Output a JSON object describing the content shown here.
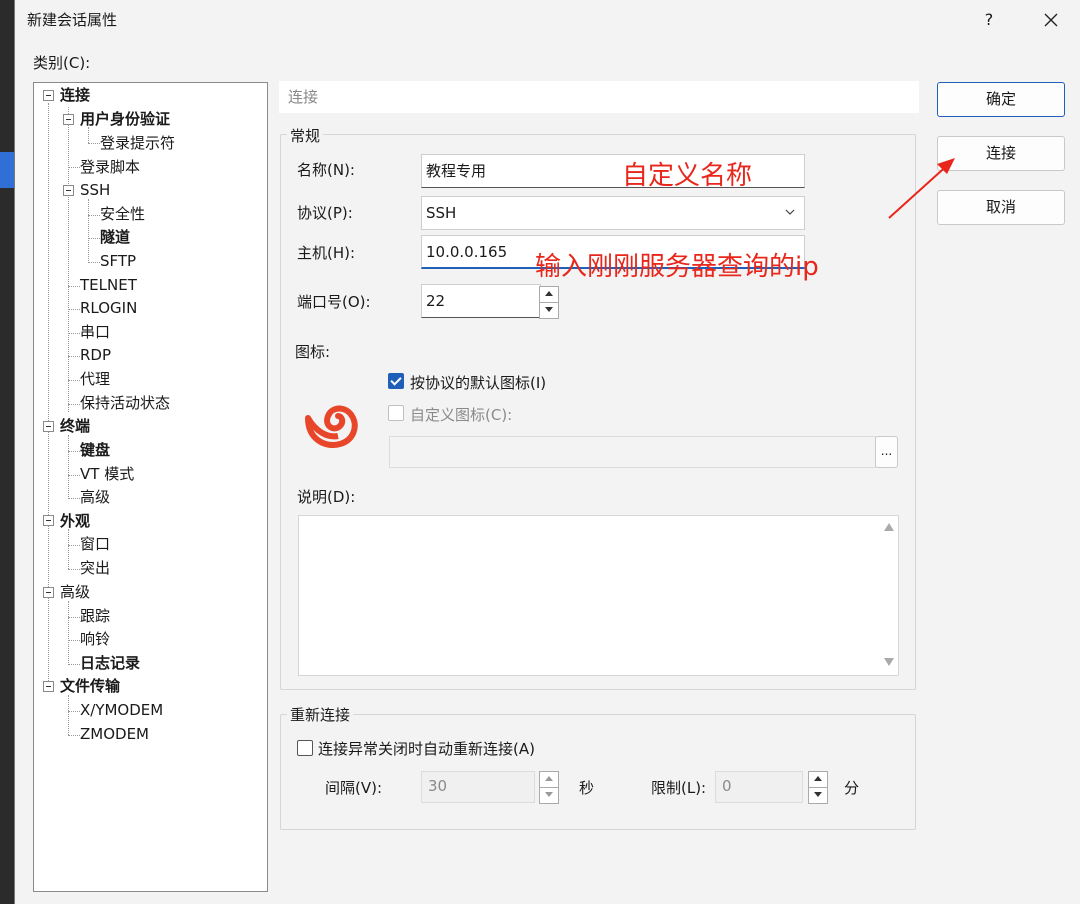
{
  "window": {
    "title": "新建会话属性",
    "help_label": "?"
  },
  "category_label": "类别(C):",
  "tree": {
    "items": [
      {
        "label": "连接",
        "bold": true
      },
      {
        "label": "用户身份验证",
        "bold": true
      },
      {
        "label": "登录提示符",
        "bold": false
      },
      {
        "label": "登录脚本",
        "bold": false
      },
      {
        "label": "SSH",
        "bold": false
      },
      {
        "label": "安全性",
        "bold": false
      },
      {
        "label": "隧道",
        "bold": true
      },
      {
        "label": "SFTP",
        "bold": false
      },
      {
        "label": "TELNET",
        "bold": false
      },
      {
        "label": "RLOGIN",
        "bold": false
      },
      {
        "label": "串口",
        "bold": false
      },
      {
        "label": "RDP",
        "bold": false
      },
      {
        "label": "代理",
        "bold": false
      },
      {
        "label": "保持活动状态",
        "bold": false
      },
      {
        "label": "终端",
        "bold": true
      },
      {
        "label": "键盘",
        "bold": true
      },
      {
        "label": "VT 模式",
        "bold": false
      },
      {
        "label": "高级",
        "bold": false
      },
      {
        "label": "外观",
        "bold": true
      },
      {
        "label": "窗口",
        "bold": false
      },
      {
        "label": "突出",
        "bold": false
      },
      {
        "label": "高级",
        "bold": false
      },
      {
        "label": "跟踪",
        "bold": false
      },
      {
        "label": "响铃",
        "bold": false
      },
      {
        "label": "日志记录",
        "bold": true
      },
      {
        "label": "文件传输",
        "bold": true
      },
      {
        "label": "X/YMODEM",
        "bold": false
      },
      {
        "label": "ZMODEM",
        "bold": false
      }
    ]
  },
  "section_header": "连接",
  "general": {
    "title": "常规",
    "name_label": "名称(N):",
    "name_value": "教程专用",
    "protocol_label": "协议(P):",
    "protocol_value": "SSH",
    "host_label": "主机(H):",
    "host_value": "10.0.0.165",
    "port_label": "端口号(O):",
    "port_value": "22",
    "icon_label": "图标:",
    "default_icon_label": "按协议的默认图标(I)",
    "custom_icon_label": "自定义图标(C):",
    "browse_label": "...",
    "desc_label": "说明(D):",
    "desc_value": ""
  },
  "reconnect": {
    "title": "重新连接",
    "auto_label": "连接异常关闭时自动重新连接(A)",
    "interval_label": "间隔(V):",
    "interval_value": "30",
    "interval_unit": "秒",
    "limit_label": "限制(L):",
    "limit_value": "0",
    "limit_unit": "分"
  },
  "buttons": {
    "ok": "确定",
    "connect": "连接",
    "cancel": "取消"
  },
  "annotations": {
    "name_note": "自定义名称",
    "host_note": "输入刚刚服务器查询的ip"
  },
  "colors": {
    "accent": "#1f5fb8",
    "annotation": "#e8261b"
  }
}
